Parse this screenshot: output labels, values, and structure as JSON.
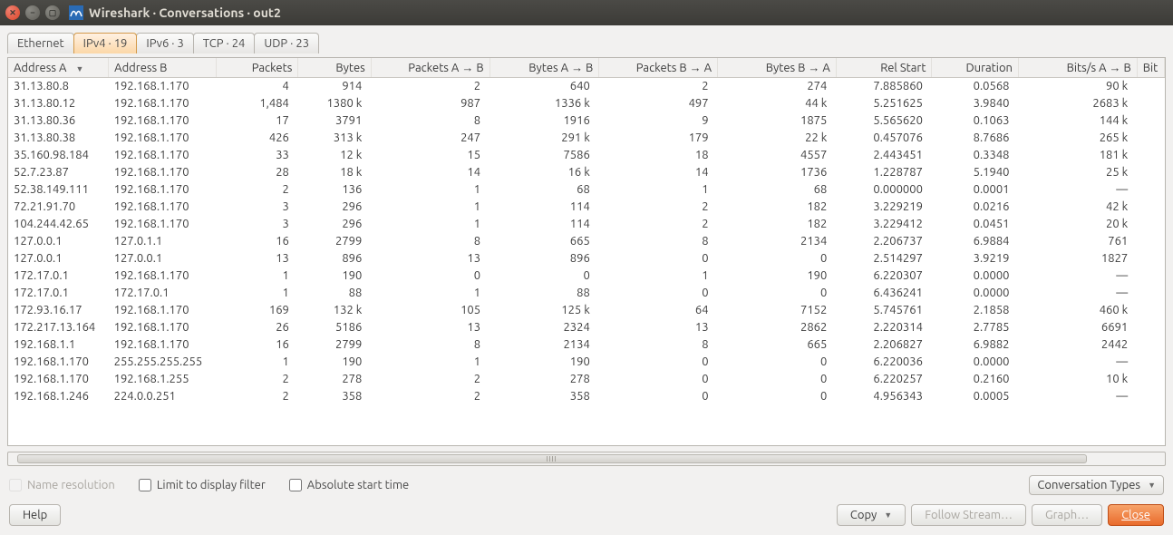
{
  "window": {
    "title": "Wireshark · Conversations · out2"
  },
  "tabs": [
    {
      "label": "Ethernet"
    },
    {
      "label": "IPv4 · 19",
      "active": true
    },
    {
      "label": "IPv6 · 3"
    },
    {
      "label": "TCP · 24"
    },
    {
      "label": "UDP · 23"
    }
  ],
  "columns": [
    {
      "label": "Address A",
      "align": "left",
      "sort": true
    },
    {
      "label": "Address B",
      "align": "left"
    },
    {
      "label": "Packets",
      "align": "right"
    },
    {
      "label": "Bytes",
      "align": "right"
    },
    {
      "label": "Packets A → B",
      "align": "right"
    },
    {
      "label": "Bytes A → B",
      "align": "right"
    },
    {
      "label": "Packets B → A",
      "align": "right"
    },
    {
      "label": "Bytes B → A",
      "align": "right"
    },
    {
      "label": "Rel Start",
      "align": "right"
    },
    {
      "label": "Duration",
      "align": "right"
    },
    {
      "label": "Bits/s A → B",
      "align": "right"
    },
    {
      "label": "Bit",
      "align": "left"
    }
  ],
  "rows": [
    [
      "31.13.80.8",
      "192.168.1.170",
      "4",
      "914",
      "2",
      "640",
      "2",
      "274",
      "7.885860",
      "0.0568",
      "90 k",
      ""
    ],
    [
      "31.13.80.12",
      "192.168.1.170",
      "1,484",
      "1380 k",
      "987",
      "1336 k",
      "497",
      "44 k",
      "5.251625",
      "3.9840",
      "2683 k",
      ""
    ],
    [
      "31.13.80.36",
      "192.168.1.170",
      "17",
      "3791",
      "8",
      "1916",
      "9",
      "1875",
      "5.565620",
      "0.1063",
      "144 k",
      ""
    ],
    [
      "31.13.80.38",
      "192.168.1.170",
      "426",
      "313 k",
      "247",
      "291 k",
      "179",
      "22 k",
      "0.457076",
      "8.7686",
      "265 k",
      ""
    ],
    [
      "35.160.98.184",
      "192.168.1.170",
      "33",
      "12 k",
      "15",
      "7586",
      "18",
      "4557",
      "2.443451",
      "0.3348",
      "181 k",
      ""
    ],
    [
      "52.7.23.87",
      "192.168.1.170",
      "28",
      "18 k",
      "14",
      "16 k",
      "14",
      "1736",
      "1.228787",
      "5.1940",
      "25 k",
      ""
    ],
    [
      "52.38.149.111",
      "192.168.1.170",
      "2",
      "136",
      "1",
      "68",
      "1",
      "68",
      "0.000000",
      "0.0001",
      "—",
      ""
    ],
    [
      "72.21.91.70",
      "192.168.1.170",
      "3",
      "296",
      "1",
      "114",
      "2",
      "182",
      "3.229219",
      "0.0216",
      "42 k",
      ""
    ],
    [
      "104.244.42.65",
      "192.168.1.170",
      "3",
      "296",
      "1",
      "114",
      "2",
      "182",
      "3.229412",
      "0.0451",
      "20 k",
      ""
    ],
    [
      "127.0.0.1",
      "127.0.1.1",
      "16",
      "2799",
      "8",
      "665",
      "8",
      "2134",
      "2.206737",
      "6.9884",
      "761",
      ""
    ],
    [
      "127.0.0.1",
      "127.0.0.1",
      "13",
      "896",
      "13",
      "896",
      "0",
      "0",
      "2.514297",
      "3.9219",
      "1827",
      ""
    ],
    [
      "172.17.0.1",
      "192.168.1.170",
      "1",
      "190",
      "0",
      "0",
      "1",
      "190",
      "6.220307",
      "0.0000",
      "—",
      ""
    ],
    [
      "172.17.0.1",
      "172.17.0.1",
      "1",
      "88",
      "1",
      "88",
      "0",
      "0",
      "6.436241",
      "0.0000",
      "—",
      ""
    ],
    [
      "172.93.16.17",
      "192.168.1.170",
      "169",
      "132 k",
      "105",
      "125 k",
      "64",
      "7152",
      "5.745761",
      "2.1858",
      "460 k",
      ""
    ],
    [
      "172.217.13.164",
      "192.168.1.170",
      "26",
      "5186",
      "13",
      "2324",
      "13",
      "2862",
      "2.220314",
      "2.7785",
      "6691",
      ""
    ],
    [
      "192.168.1.1",
      "192.168.1.170",
      "16",
      "2799",
      "8",
      "2134",
      "8",
      "665",
      "2.206827",
      "6.9882",
      "2442",
      ""
    ],
    [
      "192.168.1.170",
      "255.255.255.255",
      "1",
      "190",
      "1",
      "190",
      "0",
      "0",
      "6.220036",
      "0.0000",
      "—",
      ""
    ],
    [
      "192.168.1.170",
      "192.168.1.255",
      "2",
      "278",
      "2",
      "278",
      "0",
      "0",
      "6.220257",
      "0.2160",
      "10 k",
      ""
    ],
    [
      "192.168.1.246",
      "224.0.0.251",
      "2",
      "358",
      "2",
      "358",
      "0",
      "0",
      "4.956343",
      "0.0005",
      "—",
      ""
    ]
  ],
  "options": {
    "name_resolution": "Name resolution",
    "limit_filter": "Limit to display filter",
    "absolute_start": "Absolute start time",
    "conversation_types": "Conversation Types"
  },
  "buttons": {
    "help": "Help",
    "copy": "Copy",
    "follow": "Follow Stream…",
    "graph": "Graph…",
    "close": "Close"
  }
}
